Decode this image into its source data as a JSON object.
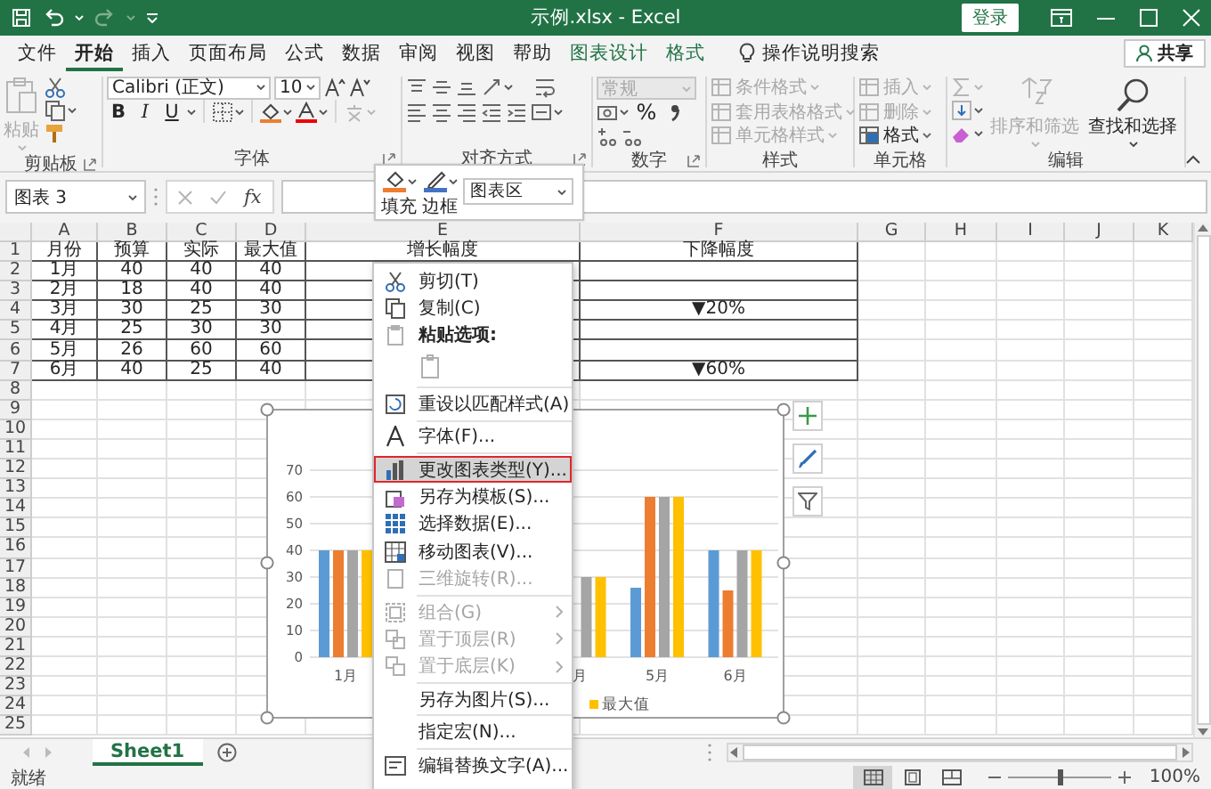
{
  "title_bar": {
    "title": "示例.xlsx - Excel",
    "sign_in": "登录"
  },
  "ribbon_tabs": [
    {
      "label": "文件",
      "selected": false,
      "kind": "standard"
    },
    {
      "label": "开始",
      "selected": true,
      "kind": "standard"
    },
    {
      "label": "插入",
      "selected": false,
      "kind": "standard"
    },
    {
      "label": "页面布局",
      "selected": false,
      "kind": "standard"
    },
    {
      "label": "公式",
      "selected": false,
      "kind": "standard"
    },
    {
      "label": "数据",
      "selected": false,
      "kind": "standard"
    },
    {
      "label": "审阅",
      "selected": false,
      "kind": "standard"
    },
    {
      "label": "视图",
      "selected": false,
      "kind": "standard"
    },
    {
      "label": "帮助",
      "selected": false,
      "kind": "standard"
    },
    {
      "label": "图表设计",
      "selected": false,
      "kind": "contextual"
    },
    {
      "label": "格式",
      "selected": false,
      "kind": "contextual"
    }
  ],
  "tell_me": "操作说明搜索",
  "share_button": "共享",
  "ribbon": {
    "clipboard": {
      "label": "剪贴板",
      "paste": {
        "label": "粘贴",
        "disabled": true
      }
    },
    "font": {
      "label": "字体",
      "font_name": "Calibri (正文)",
      "font_size": "10",
      "bold": "B",
      "italic": "I",
      "underline": "U"
    },
    "alignment": {
      "label": "对齐方式"
    },
    "number": {
      "label": "数字",
      "format": {
        "value": "常规",
        "disabled": true
      },
      "percent": "%"
    },
    "styles": {
      "label": "样式",
      "items": [
        {
          "label": "条件格式",
          "disabled": true
        },
        {
          "label": "套用表格格式",
          "disabled": true
        },
        {
          "label": "单元格样式",
          "disabled": true
        }
      ]
    },
    "cells": {
      "label": "单元格",
      "items": [
        {
          "label": "插入",
          "disabled": true
        },
        {
          "label": "删除",
          "disabled": true
        },
        {
          "label": "格式",
          "disabled": false
        }
      ]
    },
    "editing": {
      "label": "编辑",
      "items": [
        {
          "label": "排序和筛选",
          "disabled": true
        },
        {
          "label": "查找和选择",
          "disabled": false
        }
      ]
    }
  },
  "mini_toolbar": {
    "fill": "填充",
    "outline": "边框",
    "element": "图表区"
  },
  "formula_bar": {
    "name_box": "图表 3",
    "function_label": "fx"
  },
  "sheet": {
    "columns": [
      "A",
      "B",
      "C",
      "D",
      "E",
      "F",
      "G",
      "H",
      "I",
      "J",
      "K"
    ],
    "row_numbers": [
      "1",
      "2",
      "3",
      "4",
      "5",
      "6",
      "7",
      "8",
      "9",
      "10",
      "11",
      "12",
      "13",
      "14",
      "15",
      "16",
      "17",
      "18",
      "19",
      "20",
      "21",
      "22",
      "23",
      "24",
      "25"
    ],
    "rows": [
      [
        "月份",
        "预算",
        "实际",
        "最大值",
        "增长幅度",
        "下降幅度"
      ],
      [
        "1月",
        "40",
        "40",
        "40",
        null,
        null
      ],
      [
        "2月",
        "18",
        "40",
        "40",
        null,
        null
      ],
      [
        "3月",
        "30",
        "25",
        "30",
        null,
        "▼20%"
      ],
      [
        "4月",
        "25",
        "30",
        "30",
        null,
        null
      ],
      [
        "5月",
        "26",
        "60",
        "60",
        null,
        null
      ],
      [
        "6月",
        "40",
        "25",
        "40",
        null,
        "▼60%"
      ]
    ]
  },
  "chart": {
    "selected": true,
    "chart_data": {
      "type": "bar",
      "grid": true,
      "categories": [
        "1月",
        null,
        null,
        "月",
        "5月",
        "6月"
      ],
      "ylim": [
        0,
        70
      ],
      "yticks": [
        0,
        10,
        20,
        30,
        40,
        50,
        60,
        70
      ],
      "series": [
        {
          "color": "#5b9bd5",
          "values": [
            40,
            null,
            null,
            null,
            26,
            40
          ]
        },
        {
          "color": "#ed7d31",
          "values": [
            40,
            null,
            null,
            null,
            60,
            25
          ]
        },
        {
          "color": "#a5a5a5",
          "values": [
            40,
            null,
            null,
            30,
            60,
            40
          ]
        },
        {
          "name": "最大值",
          "color": "#ffc000",
          "values": [
            40,
            null,
            null,
            30,
            60,
            40
          ]
        }
      ]
    }
  },
  "context_menu": [
    {
      "kind": "command",
      "label": "剪切(T)",
      "disabled": false,
      "selected": false
    },
    {
      "kind": "command",
      "label": "复制(C)",
      "disabled": false,
      "selected": false
    },
    {
      "kind": "heading",
      "label": "粘贴选项:",
      "disabled": false,
      "selected": false
    },
    {
      "kind": "paste_option",
      "disabled": true,
      "selected": false,
      "separator_after": true
    },
    {
      "kind": "command",
      "label": "重设以匹配样式(A)",
      "disabled": false,
      "selected": false,
      "separator_after": true
    },
    {
      "kind": "command",
      "label": "字体(F)...",
      "disabled": false,
      "selected": false,
      "separator_after": true
    },
    {
      "kind": "command",
      "label": "更改图表类型(Y)...",
      "disabled": false,
      "selected": true
    },
    {
      "kind": "command",
      "label": "另存为模板(S)...",
      "disabled": false,
      "selected": false
    },
    {
      "kind": "command",
      "label": "选择数据(E)...",
      "disabled": false,
      "selected": false
    },
    {
      "kind": "command",
      "label": "移动图表(V)...",
      "disabled": false,
      "selected": false
    },
    {
      "kind": "command",
      "label": "三维旋转(R)...",
      "disabled": true,
      "selected": false,
      "separator_after": true
    },
    {
      "kind": "command",
      "label": "组合(G)",
      "disabled": true,
      "selected": false,
      "submenu": true
    },
    {
      "kind": "command",
      "label": "置于顶层(R)",
      "disabled": true,
      "selected": false,
      "submenu": true
    },
    {
      "kind": "command",
      "label": "置于底层(K)",
      "disabled": true,
      "selected": false,
      "submenu": true,
      "separator_after": true
    },
    {
      "kind": "command",
      "label": "另存为图片(S)...",
      "disabled": false,
      "selected": false,
      "separator_after": true
    },
    {
      "kind": "command",
      "label": "指定宏(N)...",
      "disabled": false,
      "selected": false,
      "separator_after": true
    },
    {
      "kind": "command",
      "label": "编辑替换文字(A)...",
      "disabled": false,
      "selected": false
    }
  ],
  "sheet_tabs": [
    {
      "label": "Sheet1",
      "selected": true
    }
  ],
  "status_bar": {
    "status": "就绪",
    "views": [
      {
        "selected": true
      },
      {
        "selected": false
      },
      {
        "selected": false
      }
    ],
    "zoom": {
      "level": 0.5,
      "reading": "100%"
    }
  }
}
